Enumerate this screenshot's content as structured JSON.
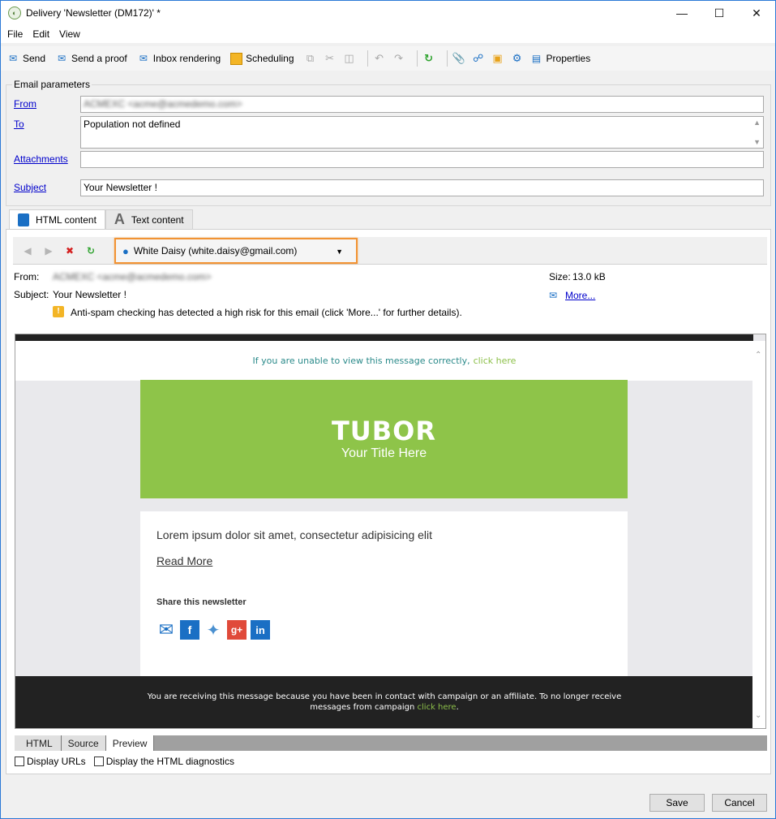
{
  "window": {
    "title": "Delivery 'Newsletter (DM172)' *"
  },
  "menu": {
    "file": "File",
    "edit": "Edit",
    "view": "View"
  },
  "toolbar": {
    "send": "Send",
    "send_proof": "Send a proof",
    "inbox_rendering": "Inbox rendering",
    "scheduling": "Scheduling",
    "properties": "Properties"
  },
  "params": {
    "legend": "Email parameters",
    "from_label": "From",
    "from_value": "ACMEXC <acme@acmedemo.com>",
    "to_label": "To",
    "to_value": "Population not defined",
    "attachments_label": "Attachments",
    "subject_label": "Subject",
    "subject_value": "Your Newsletter !"
  },
  "tabs": {
    "html": "HTML content",
    "text": "Text content"
  },
  "preview": {
    "recipient": "White Daisy  (white.daisy@gmail.com)",
    "from_label": "From:",
    "from_value": "ACMEXC <acme@acmedemo.com>",
    "subject_label": "Subject:",
    "subject_value": "Your Newsletter !",
    "size_label": "Size:",
    "size_value": "13.0 kB",
    "more": "More...",
    "warning": "Anti-spam checking has detected a high risk for this email (click 'More...' for further details)."
  },
  "email": {
    "view_text": "If you are unable to view this message correctly,",
    "view_link": "click here",
    "logo": "TUBOR",
    "title": "Your Title Here",
    "lorem": "Lorem ipsum dolor sit amet, consectetur adipisicing elit",
    "read_more": "Read More",
    "share": "Share this newsletter",
    "footer_text": "You are receiving this message because you have been in contact with campaign or an affiliate. To no longer receive messages from campaign",
    "footer_link": "click here",
    "footer_end": "."
  },
  "bottom_tabs": {
    "html": "HTML",
    "source": "Source",
    "preview": "Preview"
  },
  "options": {
    "display_urls": "Display URLs",
    "display_diag": "Display the HTML diagnostics"
  },
  "buttons": {
    "save": "Save",
    "cancel": "Cancel"
  },
  "colors": {
    "accent_orange": "#f29333",
    "banner_green": "#8ec449",
    "link_blue": "#0000cc"
  }
}
